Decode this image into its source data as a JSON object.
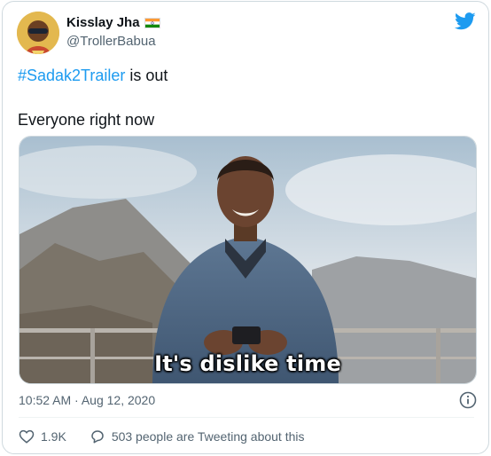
{
  "author": {
    "display_name": "Kisslay Jha",
    "handle": "@TrollerBabua",
    "flag_icon": "india-flag-icon",
    "avatar": "profile-avatar"
  },
  "brand": {
    "logo": "twitter-bird-icon",
    "color": "#1d9bf0"
  },
  "tweet": {
    "hashtag": "#Sadak2Trailer",
    "line1_rest": " is out",
    "line2": "Everyone right now"
  },
  "media": {
    "caption": "It's dislike time"
  },
  "meta": {
    "timestamp": "10:52 AM · Aug 12, 2020",
    "info_icon": "info-icon"
  },
  "actions": {
    "likes": "1.9K",
    "conversation": "503 people are Tweeting about this"
  }
}
